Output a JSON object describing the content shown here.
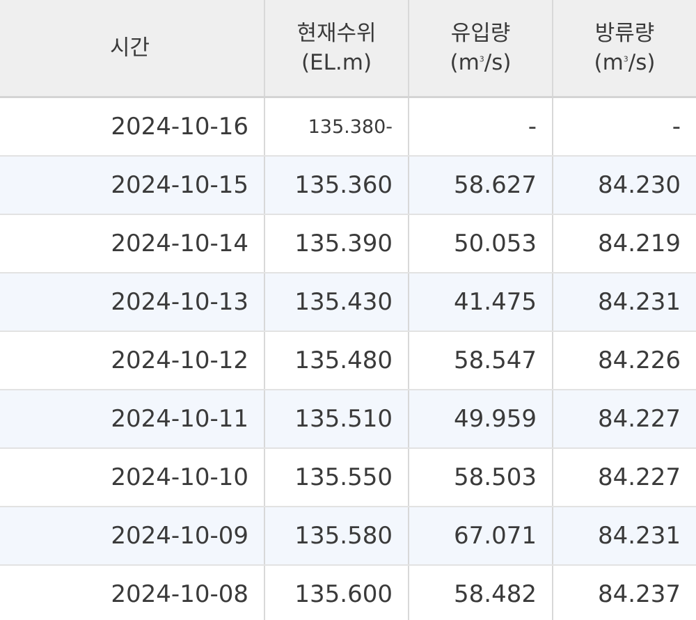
{
  "table": {
    "headers": {
      "time": "시간",
      "level": {
        "line1": "현재수위",
        "line2": "(EL.m)"
      },
      "inflow": {
        "line1": "유입량",
        "line2_pre": "(m",
        "line2_sup": "3",
        "line2_post": "/s)"
      },
      "outflow": {
        "line1": "방류량",
        "line2_pre": "(m",
        "line2_sup": "3",
        "line2_post": "/s)"
      }
    },
    "rows": [
      {
        "time": "2024-10-16",
        "level": "135.380-",
        "inflow": "-",
        "outflow": "-"
      },
      {
        "time": "2024-10-15",
        "level": "135.360",
        "inflow": "58.627",
        "outflow": "84.230"
      },
      {
        "time": "2024-10-14",
        "level": "135.390",
        "inflow": "50.053",
        "outflow": "84.219"
      },
      {
        "time": "2024-10-13",
        "level": "135.430",
        "inflow": "41.475",
        "outflow": "84.231"
      },
      {
        "time": "2024-10-12",
        "level": "135.480",
        "inflow": "58.547",
        "outflow": "84.226"
      },
      {
        "time": "2024-10-11",
        "level": "135.510",
        "inflow": "49.959",
        "outflow": "84.227"
      },
      {
        "time": "2024-10-10",
        "level": "135.550",
        "inflow": "58.503",
        "outflow": "84.227"
      },
      {
        "time": "2024-10-09",
        "level": "135.580",
        "inflow": "67.071",
        "outflow": "84.231"
      },
      {
        "time": "2024-10-08",
        "level": "135.600",
        "inflow": "58.482",
        "outflow": "84.237"
      }
    ]
  },
  "colors": {
    "header_bg": "#efefef",
    "alt_row_bg": "#f3f7fd",
    "text": "#3a3a3a",
    "border": "#d8d8d8"
  }
}
